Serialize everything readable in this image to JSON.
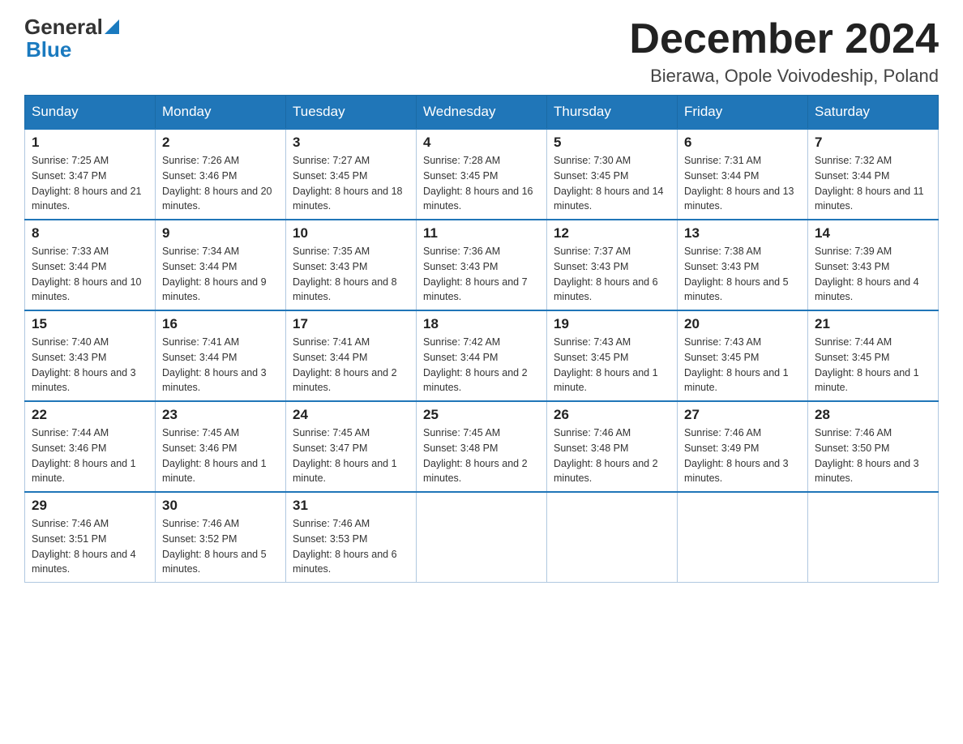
{
  "header": {
    "logo_general": "General",
    "logo_blue": "Blue",
    "month": "December 2024",
    "location": "Bierawa, Opole Voivodeship, Poland"
  },
  "weekdays": [
    "Sunday",
    "Monday",
    "Tuesday",
    "Wednesday",
    "Thursday",
    "Friday",
    "Saturday"
  ],
  "weeks": [
    [
      {
        "day": "1",
        "sunrise": "7:25 AM",
        "sunset": "3:47 PM",
        "daylight": "8 hours and 21 minutes."
      },
      {
        "day": "2",
        "sunrise": "7:26 AM",
        "sunset": "3:46 PM",
        "daylight": "8 hours and 20 minutes."
      },
      {
        "day": "3",
        "sunrise": "7:27 AM",
        "sunset": "3:45 PM",
        "daylight": "8 hours and 18 minutes."
      },
      {
        "day": "4",
        "sunrise": "7:28 AM",
        "sunset": "3:45 PM",
        "daylight": "8 hours and 16 minutes."
      },
      {
        "day": "5",
        "sunrise": "7:30 AM",
        "sunset": "3:45 PM",
        "daylight": "8 hours and 14 minutes."
      },
      {
        "day": "6",
        "sunrise": "7:31 AM",
        "sunset": "3:44 PM",
        "daylight": "8 hours and 13 minutes."
      },
      {
        "day": "7",
        "sunrise": "7:32 AM",
        "sunset": "3:44 PM",
        "daylight": "8 hours and 11 minutes."
      }
    ],
    [
      {
        "day": "8",
        "sunrise": "7:33 AM",
        "sunset": "3:44 PM",
        "daylight": "8 hours and 10 minutes."
      },
      {
        "day": "9",
        "sunrise": "7:34 AM",
        "sunset": "3:44 PM",
        "daylight": "8 hours and 9 minutes."
      },
      {
        "day": "10",
        "sunrise": "7:35 AM",
        "sunset": "3:43 PM",
        "daylight": "8 hours and 8 minutes."
      },
      {
        "day": "11",
        "sunrise": "7:36 AM",
        "sunset": "3:43 PM",
        "daylight": "8 hours and 7 minutes."
      },
      {
        "day": "12",
        "sunrise": "7:37 AM",
        "sunset": "3:43 PM",
        "daylight": "8 hours and 6 minutes."
      },
      {
        "day": "13",
        "sunrise": "7:38 AM",
        "sunset": "3:43 PM",
        "daylight": "8 hours and 5 minutes."
      },
      {
        "day": "14",
        "sunrise": "7:39 AM",
        "sunset": "3:43 PM",
        "daylight": "8 hours and 4 minutes."
      }
    ],
    [
      {
        "day": "15",
        "sunrise": "7:40 AM",
        "sunset": "3:43 PM",
        "daylight": "8 hours and 3 minutes."
      },
      {
        "day": "16",
        "sunrise": "7:41 AM",
        "sunset": "3:44 PM",
        "daylight": "8 hours and 3 minutes."
      },
      {
        "day": "17",
        "sunrise": "7:41 AM",
        "sunset": "3:44 PM",
        "daylight": "8 hours and 2 minutes."
      },
      {
        "day": "18",
        "sunrise": "7:42 AM",
        "sunset": "3:44 PM",
        "daylight": "8 hours and 2 minutes."
      },
      {
        "day": "19",
        "sunrise": "7:43 AM",
        "sunset": "3:45 PM",
        "daylight": "8 hours and 1 minute."
      },
      {
        "day": "20",
        "sunrise": "7:43 AM",
        "sunset": "3:45 PM",
        "daylight": "8 hours and 1 minute."
      },
      {
        "day": "21",
        "sunrise": "7:44 AM",
        "sunset": "3:45 PM",
        "daylight": "8 hours and 1 minute."
      }
    ],
    [
      {
        "day": "22",
        "sunrise": "7:44 AM",
        "sunset": "3:46 PM",
        "daylight": "8 hours and 1 minute."
      },
      {
        "day": "23",
        "sunrise": "7:45 AM",
        "sunset": "3:46 PM",
        "daylight": "8 hours and 1 minute."
      },
      {
        "day": "24",
        "sunrise": "7:45 AM",
        "sunset": "3:47 PM",
        "daylight": "8 hours and 1 minute."
      },
      {
        "day": "25",
        "sunrise": "7:45 AM",
        "sunset": "3:48 PM",
        "daylight": "8 hours and 2 minutes."
      },
      {
        "day": "26",
        "sunrise": "7:46 AM",
        "sunset": "3:48 PM",
        "daylight": "8 hours and 2 minutes."
      },
      {
        "day": "27",
        "sunrise": "7:46 AM",
        "sunset": "3:49 PM",
        "daylight": "8 hours and 3 minutes."
      },
      {
        "day": "28",
        "sunrise": "7:46 AM",
        "sunset": "3:50 PM",
        "daylight": "8 hours and 3 minutes."
      }
    ],
    [
      {
        "day": "29",
        "sunrise": "7:46 AM",
        "sunset": "3:51 PM",
        "daylight": "8 hours and 4 minutes."
      },
      {
        "day": "30",
        "sunrise": "7:46 AM",
        "sunset": "3:52 PM",
        "daylight": "8 hours and 5 minutes."
      },
      {
        "day": "31",
        "sunrise": "7:46 AM",
        "sunset": "3:53 PM",
        "daylight": "8 hours and 6 minutes."
      },
      null,
      null,
      null,
      null
    ]
  ]
}
